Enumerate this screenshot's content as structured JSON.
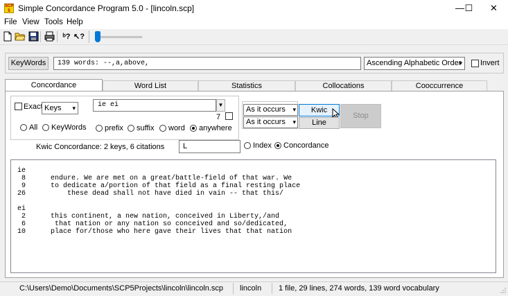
{
  "window": {
    "app_icon_text": "SCP 5",
    "title": "Simple Concordance Program 5.0 - [lincoln.scp]",
    "minimize": "—",
    "maximize": "☐",
    "close": "✕"
  },
  "menu": [
    "File",
    "View",
    "Tools",
    "Help"
  ],
  "toolbar": {
    "help_text": "ᵇ?",
    "whats_this": "↖?"
  },
  "search": {
    "keywords_button": "KeyWords",
    "summary": "139 words: --,a,above,",
    "order": "Ascending Alphabetic Order",
    "invert_label": "Invert"
  },
  "tabs": [
    "Concordance",
    "Word List",
    "Statistics",
    "Collocations",
    "Cooccurrence"
  ],
  "concordance": {
    "exact_label": "Exact",
    "keys_select": "Keys",
    "keys_value": "ie ei",
    "keys_count": "7",
    "radio_all": "All",
    "radio_keywords": "KeyWords",
    "radio_prefix": "prefix",
    "radio_suffix": "suffix",
    "radio_word": "word",
    "radio_anywhere": "anywhere",
    "sort1": "As it occurs",
    "sort2": "As it occurs",
    "kwic_button": "Kwic",
    "line_button": "Line",
    "stop_button": "Stop",
    "summary_label": "Kwic Concordance:  2 keys, 6 citations",
    "letter_value": "L",
    "radio_index": "Index",
    "radio_concordance": "Concordance"
  },
  "results": [
    "ie",
    " 8      endure. We are met on a great/battle-field of that war. We",
    " 9      to dedicate a/portion of that field as a final resting place",
    "26          these dead shall not have died in vain -- that this/",
    "",
    "ei",
    " 2      this continent, a new nation, conceived in Liberty,/and",
    " 6       that nation or any nation so conceived and so/dedicated,",
    "10      place for/those who here gave their lives that that nation"
  ],
  "status": {
    "path": "C:\\Users\\Demo\\Documents\\SCP5Projects\\lincoln\\lincoln.scp",
    "project": "lincoln",
    "stats": "1 file, 29 lines, 274 words, 139 word vocabulary"
  }
}
